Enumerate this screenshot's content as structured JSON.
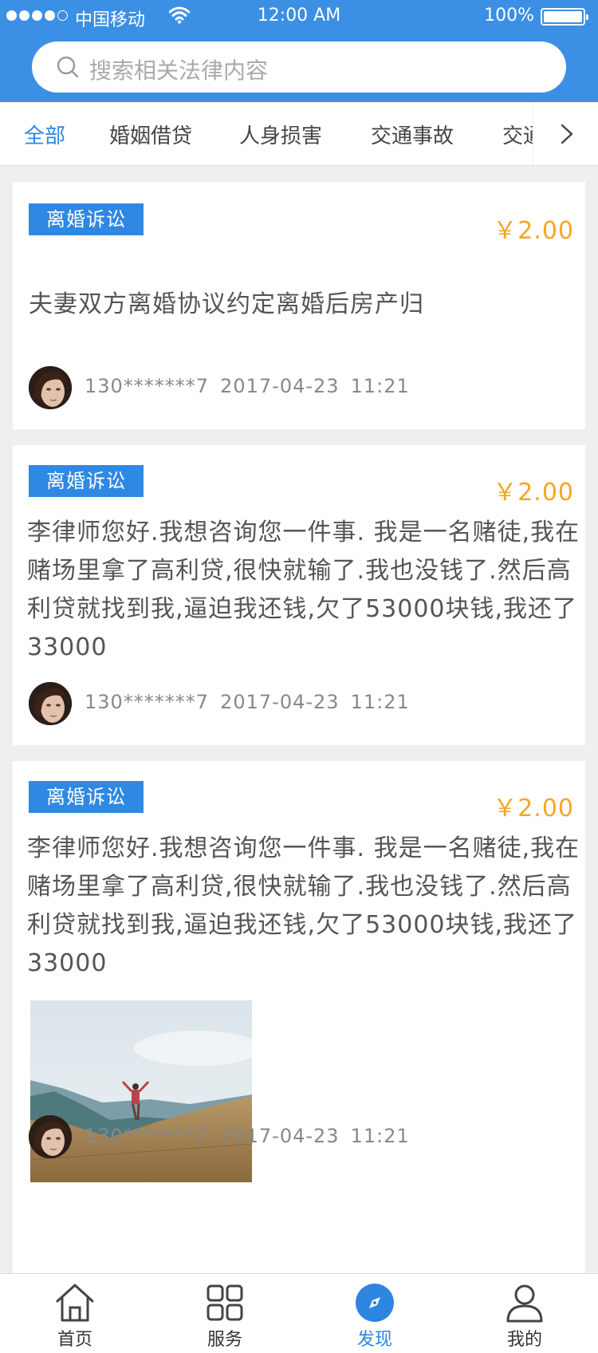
{
  "status_bar": {
    "carrier": "中国移动",
    "time": "12:00 AM",
    "battery": "100%"
  },
  "search": {
    "placeholder": "搜索相关法律内容"
  },
  "tabs": [
    {
      "label": "全部",
      "active": true
    },
    {
      "label": "婚姻借贷",
      "active": false
    },
    {
      "label": "人身损害",
      "active": false
    },
    {
      "label": "交通事故",
      "active": false
    },
    {
      "label": "交通",
      "active": false
    }
  ],
  "posts": [
    {
      "tag": "离婚诉讼",
      "price": "￥2.00",
      "text": "夫妻双方离婚协议约定离婚后房产归",
      "user": "130*******7",
      "date": "2017-04-23",
      "time": "11:21",
      "has_photo": false
    },
    {
      "tag": "离婚诉讼",
      "price": "￥2.00",
      "text": "李律师您好.我想咨询您一件事. 我是一名赌徒,我在赌场里拿了高利贷,很快就输了.我也没钱了.然后高利贷就找到我,逼迫我还钱,欠了53000块钱,我还了33000",
      "user": "130*******7",
      "date": "2017-04-23",
      "time": "11:21",
      "has_photo": false
    },
    {
      "tag": "离婚诉讼",
      "price": "￥2.00",
      "text": "李律师您好.我想咨询您一件事. 我是一名赌徒,我在赌场里拿了高利贷,很快就输了.我也没钱了.然后高利贷就找到我,逼迫我还钱,欠了53000块钱,我还了33000",
      "user": "130*******7",
      "date": "2017-04-23",
      "time": "11:21",
      "has_photo": true
    }
  ],
  "bottom_nav": [
    {
      "label": "首页",
      "icon": "home-icon",
      "active": false
    },
    {
      "label": "服务",
      "icon": "grid-icon",
      "active": false
    },
    {
      "label": "发现",
      "icon": "compass-icon",
      "active": true
    },
    {
      "label": "我的",
      "icon": "user-icon",
      "active": false
    }
  ],
  "colors": {
    "brand": "#3b8fe4",
    "active": "#2d86e0",
    "price": "#f5a623"
  }
}
